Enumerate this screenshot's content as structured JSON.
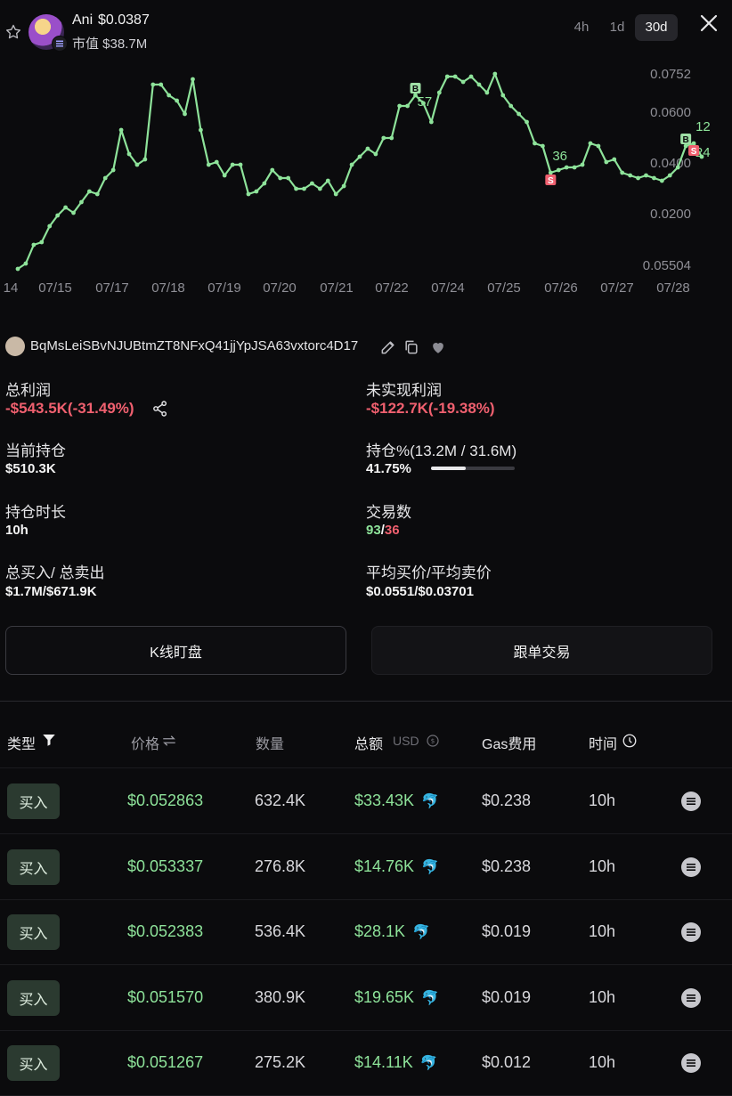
{
  "header": {
    "token_name": "Ani",
    "token_price": "$0.0387",
    "market_cap": "市值 $38.7M",
    "timeframes": [
      "4h",
      "1d",
      "30d"
    ],
    "active_timeframe": "30d"
  },
  "chart_data": {
    "type": "line",
    "color": "#8ee39a",
    "y_tick_labels": [
      "0.0752",
      "0.0600",
      "0.0400",
      "0.0200",
      "0.05504"
    ],
    "x_tick_labels": [
      "14",
      "07/15",
      "07/17",
      "07/18",
      "07/19",
      "07/20",
      "07/21",
      "07/22",
      "07/24",
      "07/25",
      "07/26",
      "07/27",
      "07/28"
    ],
    "series": [
      {
        "values": [
          0.006,
          0.008,
          0.015,
          0.016,
          0.022,
          0.026,
          0.029,
          0.027,
          0.031,
          0.035,
          0.034,
          0.04,
          0.043,
          0.058,
          0.049,
          0.045,
          0.047,
          0.075,
          0.075,
          0.071,
          0.069,
          0.064,
          0.077,
          0.058,
          0.045,
          0.046,
          0.041,
          0.045,
          0.045,
          0.034,
          0.035,
          0.038,
          0.043,
          0.04,
          0.04,
          0.036,
          0.036,
          0.038,
          0.036,
          0.039,
          0.034,
          0.037,
          0.045,
          0.048,
          0.051,
          0.049,
          0.055,
          0.055,
          0.067,
          0.067,
          0.071,
          0.068,
          0.061,
          0.072,
          0.078,
          0.078,
          0.076,
          0.078,
          0.075,
          0.072,
          0.079,
          0.071,
          0.067,
          0.064,
          0.061,
          0.053,
          0.052,
          0.042,
          0.043,
          0.044,
          0.044,
          0.045,
          0.053,
          0.052,
          0.046,
          0.047,
          0.042,
          0.041,
          0.04,
          0.041,
          0.04,
          0.039,
          0.041,
          0.044,
          0.052,
          0.053,
          0.048
        ]
      }
    ],
    "markers": [
      {
        "type": "B",
        "label": "57",
        "index": 50
      },
      {
        "type": "S",
        "label": "36",
        "index": 67
      },
      {
        "type": "B",
        "label": "+24",
        "index": 84
      },
      {
        "type": "S",
        "label": "12",
        "index": 85
      }
    ]
  },
  "wallet": {
    "address": "BqMsLeiSBvNJUBtmZT8NFxQ41jjYpJSA63vxtorc4D17"
  },
  "stats": {
    "total_profit_label": "总利润",
    "total_profit_value": "-$543.5K(-31.49%)",
    "unrealized_label": "未实现利润",
    "unrealized_value": "-$122.7K(-19.38%)",
    "holding_label": "当前持仓",
    "holding_value": "$510.3K",
    "holding_pct_label": "持仓%(13.2M / 31.6M)",
    "holding_pct_value": "41.75%",
    "holding_pct_fraction": 0.4175,
    "duration_label": "持仓时长",
    "duration_value": "10h",
    "trades_label": "交易数",
    "trades_buy": "93",
    "trades_sep": "/",
    "trades_sell": "36",
    "buy_sell_label": "总买入/ 总卖出",
    "buy_sell_value": "$1.7M/$671.9K",
    "avg_price_label": "平均买价/平均卖价",
    "avg_price_value": "$0.0551/$0.03701"
  },
  "buttons": {
    "kline": "K线盯盘",
    "copy_trade": "跟单交易"
  },
  "table": {
    "headers": {
      "type": "类型",
      "price": "价格",
      "qty": "数量",
      "total": "总额",
      "currency": "USD",
      "gas": "Gas费用",
      "time": "时间"
    },
    "rows": [
      {
        "type": "买入",
        "price": "$0.052863",
        "qty": "632.4K",
        "total": "$33.43K",
        "gas": "$0.238",
        "time": "10h"
      },
      {
        "type": "买入",
        "price": "$0.053337",
        "qty": "276.8K",
        "total": "$14.76K",
        "gas": "$0.238",
        "time": "10h"
      },
      {
        "type": "买入",
        "price": "$0.052383",
        "qty": "536.4K",
        "total": "$28.1K",
        "gas": "$0.019",
        "time": "10h"
      },
      {
        "type": "买入",
        "price": "$0.051570",
        "qty": "380.9K",
        "total": "$19.65K",
        "gas": "$0.019",
        "time": "10h"
      },
      {
        "type": "买入",
        "price": "$0.051267",
        "qty": "275.2K",
        "total": "$14.11K",
        "gas": "$0.012",
        "time": "10h"
      }
    ]
  }
}
